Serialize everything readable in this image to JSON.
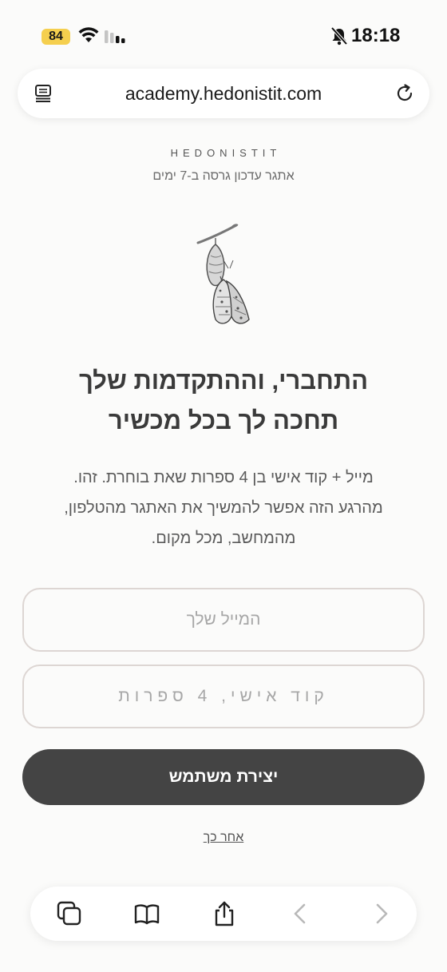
{
  "status_bar": {
    "battery_level": "84",
    "time": "18:18",
    "icons": [
      "wifi-icon",
      "cellular-signal-icon",
      "silent-bell-icon"
    ]
  },
  "browser": {
    "url": "academy.hedonistit.com",
    "icons": [
      "reader-mode-icon",
      "reload-icon"
    ]
  },
  "page": {
    "brand": "HEDONISTIT",
    "update_note": "אתגר עדכון גרסה ב-7 ימים",
    "illustration": "butterfly-chrysalis-illustration",
    "headline_line1": "התחברי, וההתקדמות שלך",
    "headline_line2": "תחכה לך בכל מכשיר",
    "body_line1": "מייל + קוד אישי בן 4 ספרות שאת בוחרת. זהו.",
    "body_line2": "מהרגע הזה אפשר להמשיך את האתגר מהטלפון,",
    "body_line3": "מהמחשב, מכל מקום.",
    "email_placeholder": "המייל שלך",
    "code_placeholder": "קוד אישי, 4 ספרות",
    "submit_label": "יצירת משתמש",
    "later_label": "אחר כך"
  },
  "toolbar": {
    "icons": [
      "tabs-icon",
      "bookmarks-icon",
      "share-icon",
      "back-chevron-icon",
      "forward-chevron-icon"
    ]
  },
  "colors": {
    "background": "#fbfbfa",
    "button": "#444444",
    "battery": "#f5cf4e",
    "field_border": "#ddd6d3"
  }
}
